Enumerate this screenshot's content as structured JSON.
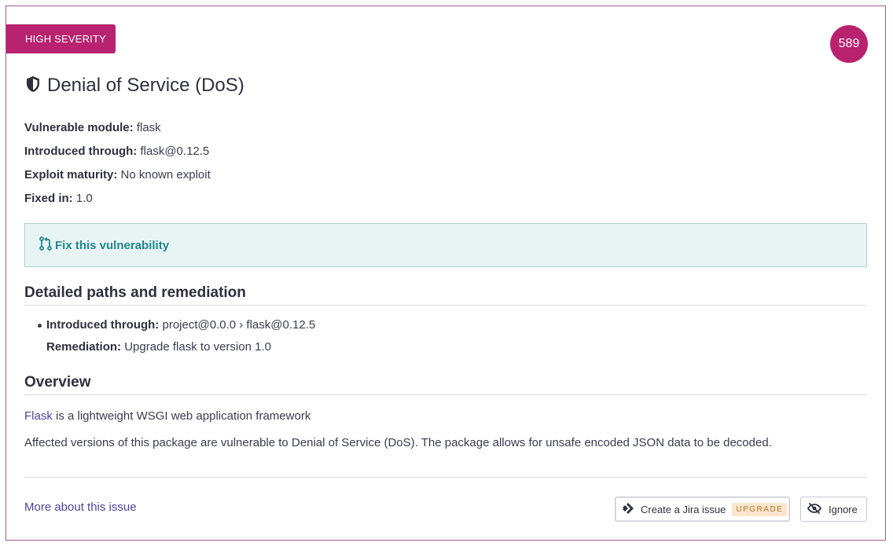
{
  "header": {
    "severity_label": "HIGH SEVERITY",
    "score": "589",
    "title": "Denial of Service (DoS)"
  },
  "meta": {
    "vulnerable_module_label": "Vulnerable module:",
    "vulnerable_module_value": "flask",
    "introduced_through_label": "Introduced through:",
    "introduced_through_value": "flask@0.12.5",
    "exploit_maturity_label": "Exploit maturity:",
    "exploit_maturity_value": "No known exploit",
    "fixed_in_label": "Fixed in:",
    "fixed_in_value": "1.0"
  },
  "fix": {
    "label": "Fix this vulnerability"
  },
  "paths": {
    "heading": "Detailed paths and remediation",
    "introduced_label": "Introduced through:",
    "introduced_value": "project@0.0.0 › flask@0.12.5",
    "remediation_label": "Remediation:",
    "remediation_value": "Upgrade flask to version 1.0"
  },
  "overview": {
    "heading": "Overview",
    "line1_link": "Flask",
    "line1_text": " is a lightweight WSGI web application framework",
    "line2_text": "Affected versions of this package are vulnerable to Denial of Service (DoS). The package allows for unsafe encoded JSON data to be decoded."
  },
  "footer": {
    "more_link": "More about this issue",
    "jira_button": "Create a Jira issue",
    "upgrade_tag": "UPGRADE",
    "ignore_button": "Ignore"
  },
  "colors": {
    "severity": "#b8226f",
    "fix_text": "#1f878f",
    "fix_bg": "#e8f4f4",
    "link": "#4b45a1",
    "border": "#a5579a"
  },
  "icons": {
    "title_icon": "shield-icon",
    "fix_icon": "pull-request-icon",
    "jira_icon": "jira-icon",
    "ignore_icon": "eye-off-icon"
  }
}
